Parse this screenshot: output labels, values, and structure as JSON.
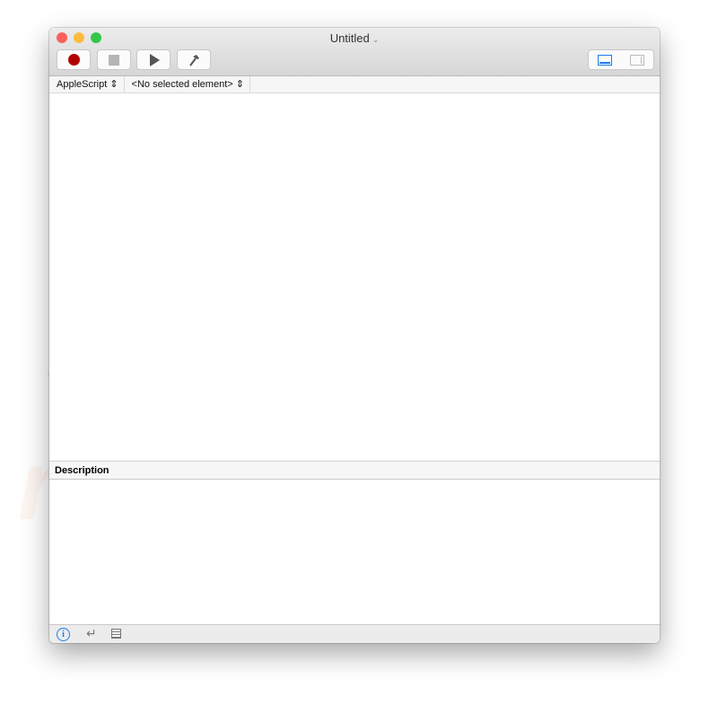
{
  "window": {
    "title": "Untitled",
    "title_icon": "chevron-down-icon",
    "traffic_lights": {
      "close": "#fc605c",
      "minimize": "#fdbc40",
      "zoom": "#34c84a"
    }
  },
  "toolbar": {
    "buttons": [
      {
        "name": "record-button",
        "icon": "record-icon",
        "color": "#b30000"
      },
      {
        "name": "stop-button",
        "icon": "stop-icon",
        "color": "#b5b5b5"
      },
      {
        "name": "run-button",
        "icon": "play-icon",
        "color": "#555555"
      },
      {
        "name": "compile-button",
        "icon": "hammer-icon",
        "color": "#555555"
      }
    ],
    "view_toggle": {
      "selected": "bottom-pane",
      "accent": "#1a7df0"
    }
  },
  "navigation": {
    "language": "AppleScript",
    "element": "<No selected element>"
  },
  "description": {
    "header": "Description"
  },
  "bottombar": {
    "icons": [
      "info-icon",
      "return-icon",
      "list-icon"
    ]
  },
  "watermark": {
    "text": "PC risk.com"
  }
}
